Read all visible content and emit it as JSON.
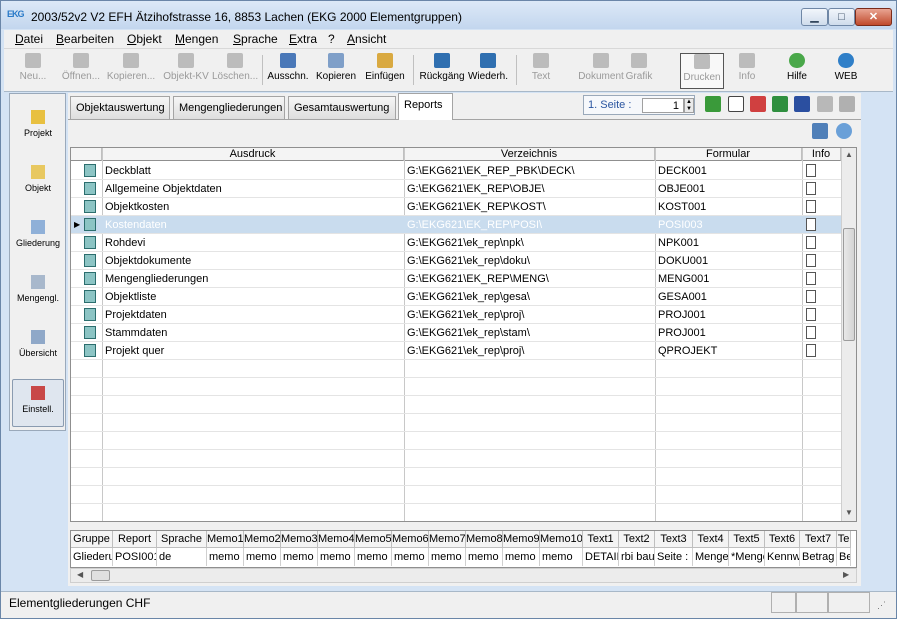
{
  "window": {
    "title": "2003/52v2 V2 EFH Ätzihofstrasse 16, 8853 Lachen (EKG 2000 Elementgruppen)",
    "icon_text": "EKG"
  },
  "menu": [
    "Datei",
    "Bearbeiten",
    "Objekt",
    "Mengen",
    "Sprache",
    "Extra",
    "?",
    "Ansicht"
  ],
  "toolbar": {
    "buttons": [
      {
        "label": "Neu...",
        "enabled": false
      },
      {
        "label": "Öffnen...",
        "enabled": false
      },
      {
        "label": "Kopieren...",
        "enabled": false
      },
      {
        "label": "Objekt-KV",
        "enabled": false
      },
      {
        "label": "Löschen...",
        "enabled": false
      },
      {
        "label": "Ausschn.",
        "enabled": true
      },
      {
        "label": "Kopieren",
        "enabled": true
      },
      {
        "label": "Einfügen",
        "enabled": true
      },
      {
        "label": "Rückgäng",
        "enabled": true
      },
      {
        "label": "Wiederh.",
        "enabled": true
      },
      {
        "label": "Text",
        "enabled": false
      },
      {
        "label": "Dokument",
        "enabled": false
      },
      {
        "label": "Grafik",
        "enabled": false
      },
      {
        "label": "Drucken",
        "enabled": false
      },
      {
        "label": "Info",
        "enabled": false
      },
      {
        "label": "Hilfe",
        "enabled": true
      },
      {
        "label": "WEB",
        "enabled": true
      }
    ]
  },
  "sidebar": [
    {
      "label": "Projekt",
      "icon": "project-icon"
    },
    {
      "label": "Objekt",
      "icon": "object-icon"
    },
    {
      "label": "Gliederung",
      "icon": "structure-icon"
    },
    {
      "label": "Mengengl.",
      "icon": "quantity-icon"
    },
    {
      "label": "Übersicht",
      "icon": "overview-icon"
    },
    {
      "label": "Einstell.",
      "icon": "settings-icon"
    }
  ],
  "tabs": [
    {
      "label": "Objektauswertung",
      "active": false
    },
    {
      "label": "Mengengliederungen",
      "active": false
    },
    {
      "label": "Gesamtauswertung",
      "active": false
    },
    {
      "label": "Reports",
      "active": true
    }
  ],
  "pager": {
    "label": "1. Seite :",
    "value": "1"
  },
  "grid": {
    "headers": [
      "Ausdruck",
      "Verzeichnis",
      "Formular",
      "Info"
    ],
    "selected_row": 3,
    "rows": [
      {
        "ausdruck": "Deckblatt",
        "verzeichnis": "G:\\EKG621\\EK_REP_PBK\\DECK\\",
        "formular": "DECK001"
      },
      {
        "ausdruck": "Allgemeine Objektdaten",
        "verzeichnis": "G:\\EKG621\\EK_REP\\OBJE\\",
        "formular": "OBJE001"
      },
      {
        "ausdruck": "Objektkosten",
        "verzeichnis": "G:\\EKG621\\EK_REP\\KOST\\",
        "formular": "KOST001"
      },
      {
        "ausdruck": "Kostendaten",
        "verzeichnis": "G:\\EKG621\\EK_REP\\POSI\\",
        "formular": "POSI003"
      },
      {
        "ausdruck": "Rohdevi",
        "verzeichnis": "G:\\EKG621\\ek_rep\\npk\\",
        "formular": "NPK001"
      },
      {
        "ausdruck": "Objektdokumente",
        "verzeichnis": "G:\\EKG621\\ek_rep\\doku\\",
        "formular": "DOKU001"
      },
      {
        "ausdruck": "Mengengliederungen",
        "verzeichnis": "G:\\EKG621\\EK_REP\\MENG\\",
        "formular": "MENG001"
      },
      {
        "ausdruck": "Objektliste",
        "verzeichnis": "G:\\EKG621\\ek_rep\\gesa\\",
        "formular": "GESA001"
      },
      {
        "ausdruck": "Projektdaten",
        "verzeichnis": "G:\\EKG621\\ek_rep\\proj\\",
        "formular": "PROJ001"
      },
      {
        "ausdruck": "Stammdaten",
        "verzeichnis": "G:\\EKG621\\ek_rep\\stam\\",
        "formular": "PROJ001"
      },
      {
        "ausdruck": "Projekt quer",
        "verzeichnis": "G:\\EKG621\\ek_rep\\proj\\",
        "formular": "QPROJEKT"
      }
    ]
  },
  "detail": {
    "headers": [
      "Gruppe",
      "Report",
      "Sprache",
      "Memo1",
      "Memo2",
      "Memo3",
      "Memo4",
      "Memo5",
      "Memo6",
      "Memo7",
      "Memo8",
      "Memo9",
      "Memo10",
      "Text1",
      "Text2",
      "Text3",
      "Text4",
      "Text5",
      "Text6",
      "Text7",
      "Te"
    ],
    "values": [
      "Gliederu",
      "POSI001",
      "de",
      "memo",
      "memo",
      "memo",
      "memo",
      "memo",
      "memo",
      "memo",
      "memo",
      "memo",
      "memo",
      "DETAIL",
      "rbi bau",
      "Seite :",
      "Menge",
      "*Menge",
      "Kennw",
      "Betrag",
      "Be"
    ]
  },
  "status": {
    "text": "Elementgliederungen CHF"
  },
  "colors": {
    "selection": "#c9dcee",
    "frame": "#d4e3f4"
  }
}
